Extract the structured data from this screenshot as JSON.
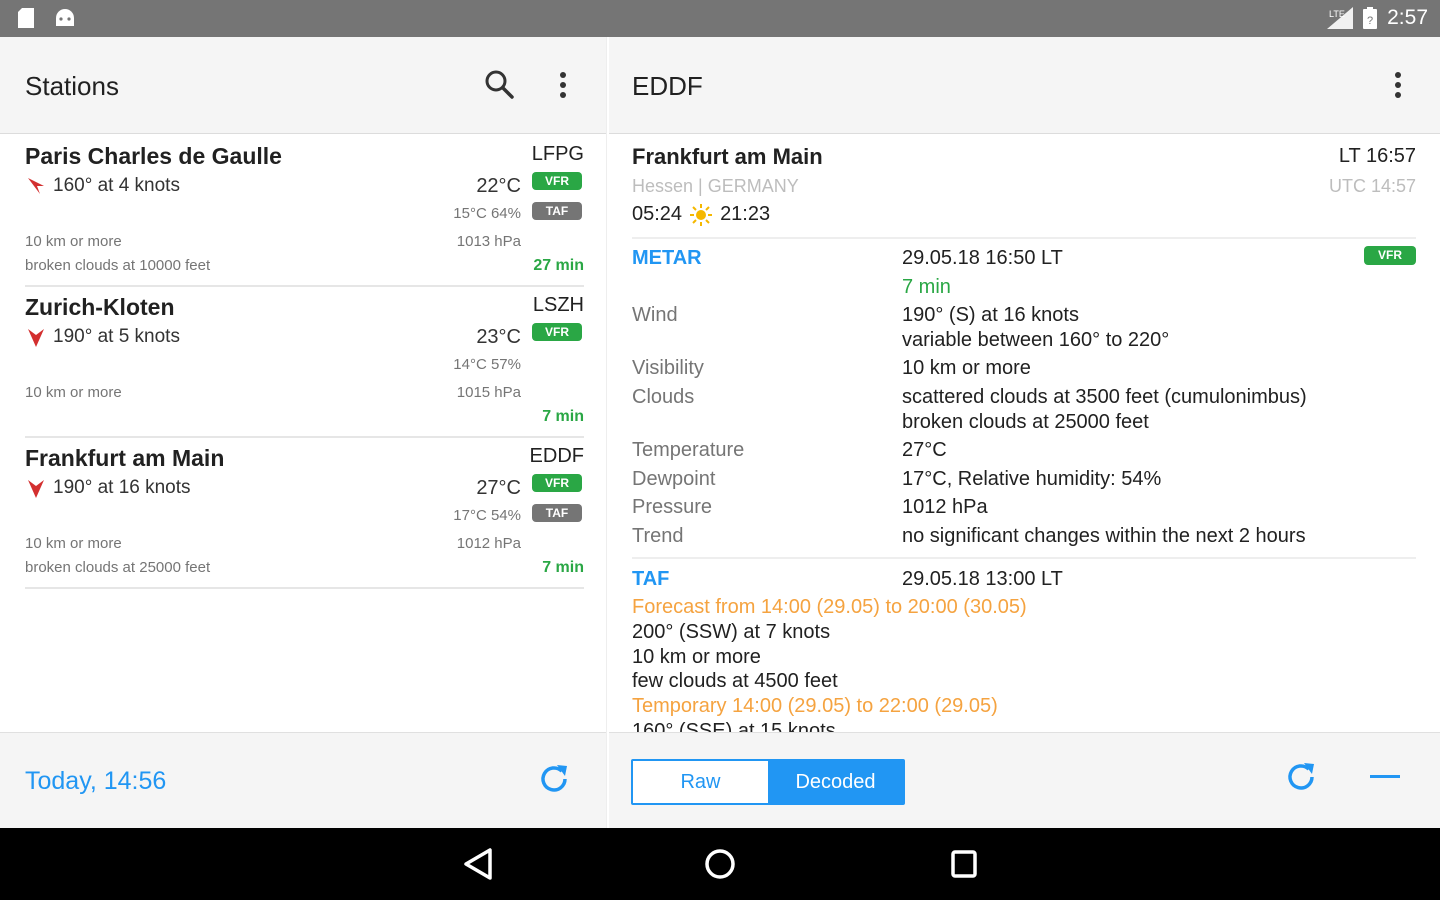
{
  "status_bar": {
    "network": "LTE",
    "time": "2:57"
  },
  "left": {
    "title": "Stations",
    "updated": "Today, 14:56",
    "stations": [
      {
        "name": "Paris Charles de Gaulle",
        "code": "LFPG",
        "wind": "160° at 4 knots",
        "temp": "22°C",
        "humidity": "15°C 64%",
        "pressure": "1013 hPa",
        "visibility": "10 km or more",
        "clouds": "broken clouds at 10000 feet",
        "age": "27 min",
        "flight_rules": "VFR",
        "taf": "TAF"
      },
      {
        "name": "Zurich-Kloten",
        "code": "LSZH",
        "wind": "190° at 5 knots",
        "temp": "23°C",
        "humidity": "14°C 57%",
        "pressure": "1015 hPa",
        "visibility": "10 km or more",
        "clouds": "",
        "age": "7 min",
        "flight_rules": "VFR",
        "taf": ""
      },
      {
        "name": "Frankfurt am Main",
        "code": "EDDF",
        "wind": "190° at 16 knots",
        "temp": "27°C",
        "humidity": "17°C 54%",
        "pressure": "1012 hPa",
        "visibility": "10 km or more",
        "clouds": "broken clouds at 25000 feet",
        "age": "7 min",
        "flight_rules": "VFR",
        "taf": "TAF"
      }
    ]
  },
  "right": {
    "title": "EDDF",
    "station_name": "Frankfurt am Main",
    "local_time": "LT 16:57",
    "region": "Hessen | GERMANY",
    "utc_time": "UTC 14:57",
    "sunrise": "05:24",
    "sunset": "21:23",
    "metar": {
      "label": "METAR",
      "time": "29.05.18 16:50 LT",
      "age": "7 min",
      "flight_rules": "VFR",
      "wind_label": "Wind",
      "wind": "190° (S) at 16 knots",
      "wind_var": "variable between 160° to 220°",
      "visibility_label": "Visibility",
      "visibility": "10 km or more",
      "clouds_label": "Clouds",
      "clouds_1": "scattered clouds at 3500 feet (cumulonimbus)",
      "clouds_2": "broken clouds at 25000 feet",
      "temperature_label": "Temperature",
      "temperature": "27°C",
      "dewpoint_label": "Dewpoint",
      "dewpoint": "17°C, Relative humidity: 54%",
      "pressure_label": "Pressure",
      "pressure": "1012 hPa",
      "trend_label": "Trend",
      "trend": "no significant changes within the next 2 hours"
    },
    "taf": {
      "label": "TAF",
      "time": "29.05.18 13:00 LT",
      "forecast": "Forecast from 14:00 (29.05) to 20:00 (30.05)",
      "wind": "200° (SSW) at 7 knots",
      "visibility": "10 km or more",
      "clouds": "few clouds at 4500 feet",
      "temporary": "Temporary 14:00 (29.05) to 22:00 (29.05)",
      "temp_wind": "160° (SSE) at 15 knots"
    },
    "toggle": {
      "raw": "Raw",
      "decoded": "Decoded",
      "selected": "Decoded"
    }
  },
  "colors": {
    "accent": "#2196f3",
    "vfr": "#2aa745",
    "forecast": "#f5a340",
    "wind_arrow": "#d32f2f"
  }
}
